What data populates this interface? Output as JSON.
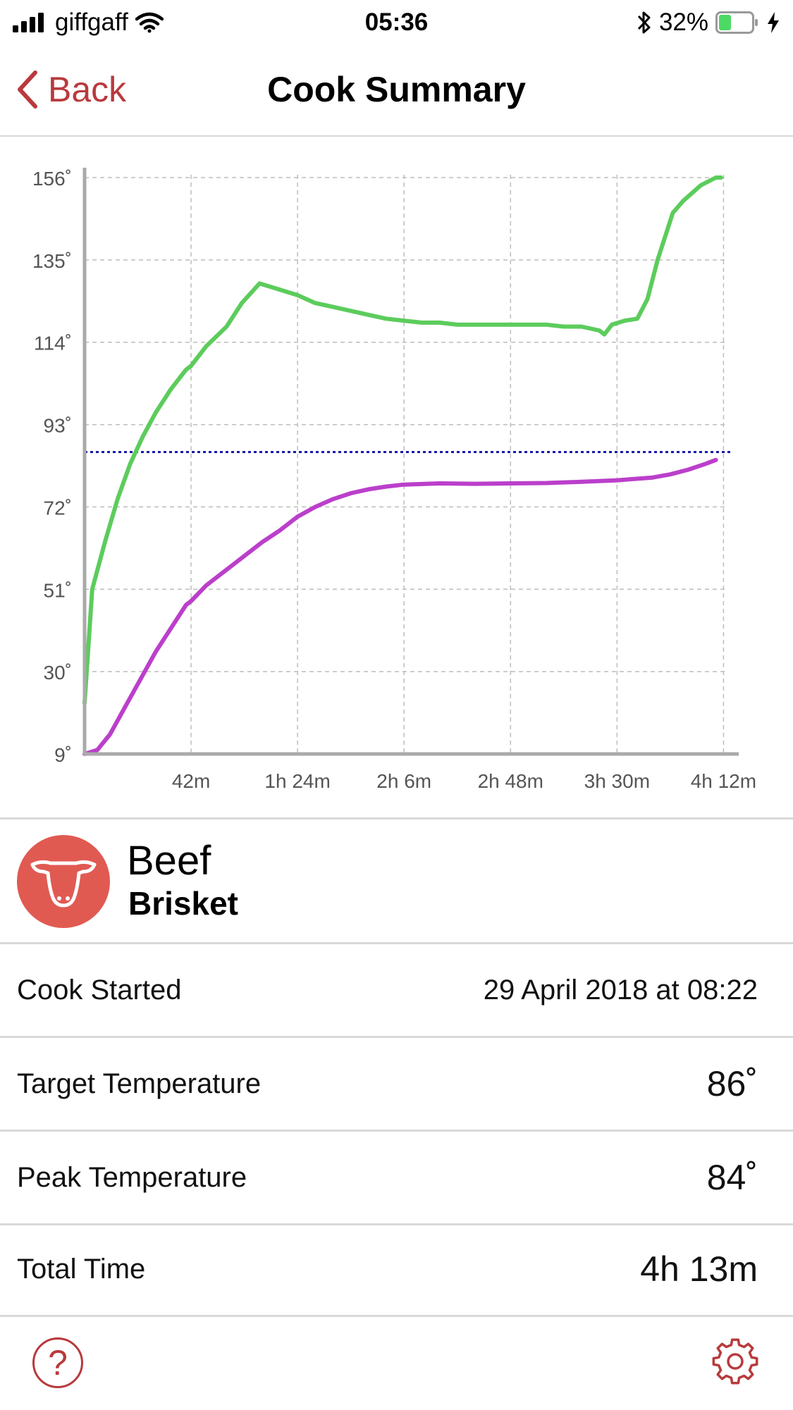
{
  "status_bar": {
    "carrier": "giffgaff",
    "time": "05:36",
    "battery": "32%"
  },
  "nav": {
    "back_label": "Back",
    "title": "Cook Summary"
  },
  "colors": {
    "accent": "#b83a3d",
    "ambient_line": "#5ccc5c",
    "meat_line": "#bb3fcb",
    "target_line": "#1a1aaa",
    "food_badge": "#e05a52"
  },
  "chart_data": {
    "type": "line",
    "x_unit": "minutes",
    "x_ticks": [
      {
        "value": 42,
        "label": "42m"
      },
      {
        "value": 84,
        "label": "1h 24m"
      },
      {
        "value": 126,
        "label": "2h 6m"
      },
      {
        "value": 168,
        "label": "2h 48m"
      },
      {
        "value": 210,
        "label": "3h 30m"
      },
      {
        "value": 252,
        "label": "4h 12m"
      }
    ],
    "y_ticks": [
      {
        "value": 9,
        "label": "9˚"
      },
      {
        "value": 30,
        "label": "30˚"
      },
      {
        "value": 51,
        "label": "51˚"
      },
      {
        "value": 72,
        "label": "72˚"
      },
      {
        "value": 93,
        "label": "93˚"
      },
      {
        "value": 114,
        "label": "114˚"
      },
      {
        "value": 135,
        "label": "135˚"
      },
      {
        "value": 156,
        "label": "156˚"
      }
    ],
    "xlim": [
      0,
      253
    ],
    "ylim": [
      9,
      156
    ],
    "grid": true,
    "series": [
      {
        "role": "ambient",
        "color": "#5ccc5c",
        "x": [
          0,
          3,
          8,
          13,
          18,
          23,
          28,
          34,
          40,
          42,
          48,
          56,
          62,
          69,
          74,
          84,
          91,
          98,
          105,
          112,
          119,
          126,
          133,
          140,
          147,
          154,
          161,
          168,
          175,
          182,
          189,
          196,
          203,
          205,
          208,
          213,
          218,
          222,
          226,
          232,
          236,
          243,
          249,
          251
        ],
        "y": [
          22,
          51,
          63,
          74,
          83,
          90,
          96,
          102,
          107,
          108,
          113,
          118,
          124,
          129,
          128,
          126,
          124,
          123,
          122,
          121,
          120,
          119.5,
          119,
          119,
          118.5,
          118.5,
          118.5,
          118.5,
          118.5,
          118.5,
          118,
          118,
          117,
          116,
          118.5,
          119.5,
          120,
          125,
          135,
          147,
          150,
          154,
          156,
          156
        ]
      },
      {
        "role": "meat",
        "color": "#bb3fcb",
        "x": [
          0,
          5,
          10,
          16,
          22,
          28,
          34,
          40,
          42,
          48,
          56,
          63,
          70,
          77,
          84,
          91,
          98,
          105,
          112,
          119,
          126,
          140,
          154,
          168,
          182,
          196,
          210,
          224,
          231,
          238,
          245,
          249
        ],
        "y": [
          9,
          10,
          14,
          21,
          28,
          35,
          41,
          47,
          48,
          52,
          56,
          59.5,
          63,
          66,
          69.5,
          72,
          74,
          75.5,
          76.5,
          77.2,
          77.7,
          78,
          77.9,
          78,
          78.1,
          78.4,
          78.8,
          79.5,
          80.3,
          81.5,
          83,
          84
        ]
      }
    ],
    "reference_lines": [
      {
        "role": "target",
        "y": 86,
        "color": "#1a1aaa",
        "style": "dotted"
      }
    ]
  },
  "food": {
    "icon": "cow-head-icon",
    "name": "Beef",
    "cut": "Brisket"
  },
  "details": [
    {
      "label": "Cook Started",
      "value": "29 April 2018 at 08:22"
    },
    {
      "label": "Target Temperature",
      "value": "86˚"
    },
    {
      "label": "Peak Temperature",
      "value": "84˚"
    },
    {
      "label": "Total Time",
      "value": "4h 13m"
    }
  ],
  "tab_bar": {
    "left_icon": "help-circle-icon",
    "help_symbol": "?",
    "right_icon": "gear-icon"
  }
}
